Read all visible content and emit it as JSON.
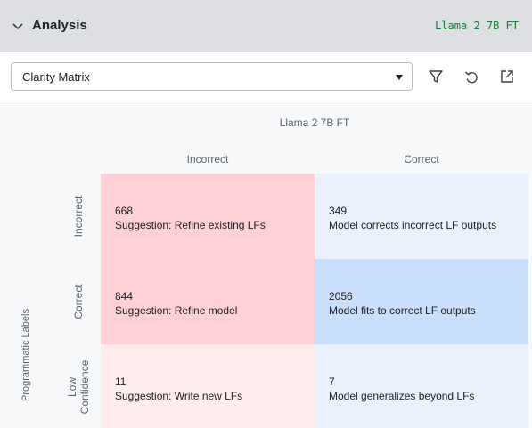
{
  "panel": {
    "title": "Analysis",
    "model_tag": "Llama 2 7B FT"
  },
  "toolbar": {
    "view_select": "Clarity Matrix",
    "icons": [
      "filter-icon",
      "undo-icon",
      "open-external-icon"
    ]
  },
  "matrix": {
    "column_axis_label": "Llama 2 7B FT",
    "columns": [
      "Incorrect",
      "Correct"
    ],
    "row_axis_label": "Programmatic Labels",
    "rows": [
      "Incorrect",
      "Correct",
      "Low\nConfidence"
    ],
    "cells": [
      [
        {
          "count": "668",
          "text": "Suggestion: Refine existing LFs"
        },
        {
          "count": "349",
          "text": "Model corrects incorrect LF outputs"
        }
      ],
      [
        {
          "count": "844",
          "text": "Suggestion: Refine model"
        },
        {
          "count": "2056",
          "text": "Model fits to correct LF outputs"
        }
      ],
      [
        {
          "count": "11",
          "text": "Suggestion: Write new LFs"
        },
        {
          "count": "7",
          "text": "Model generalizes beyond LFs"
        }
      ]
    ]
  },
  "colors": {
    "header_bg": "#dddfe2",
    "model_tag": "#1e7a3a",
    "cell_red": "#ffd1d6",
    "cell_light_red": "#ffeced",
    "cell_blue": "#cadffb",
    "cell_light_blue": "#eaf1fc"
  }
}
